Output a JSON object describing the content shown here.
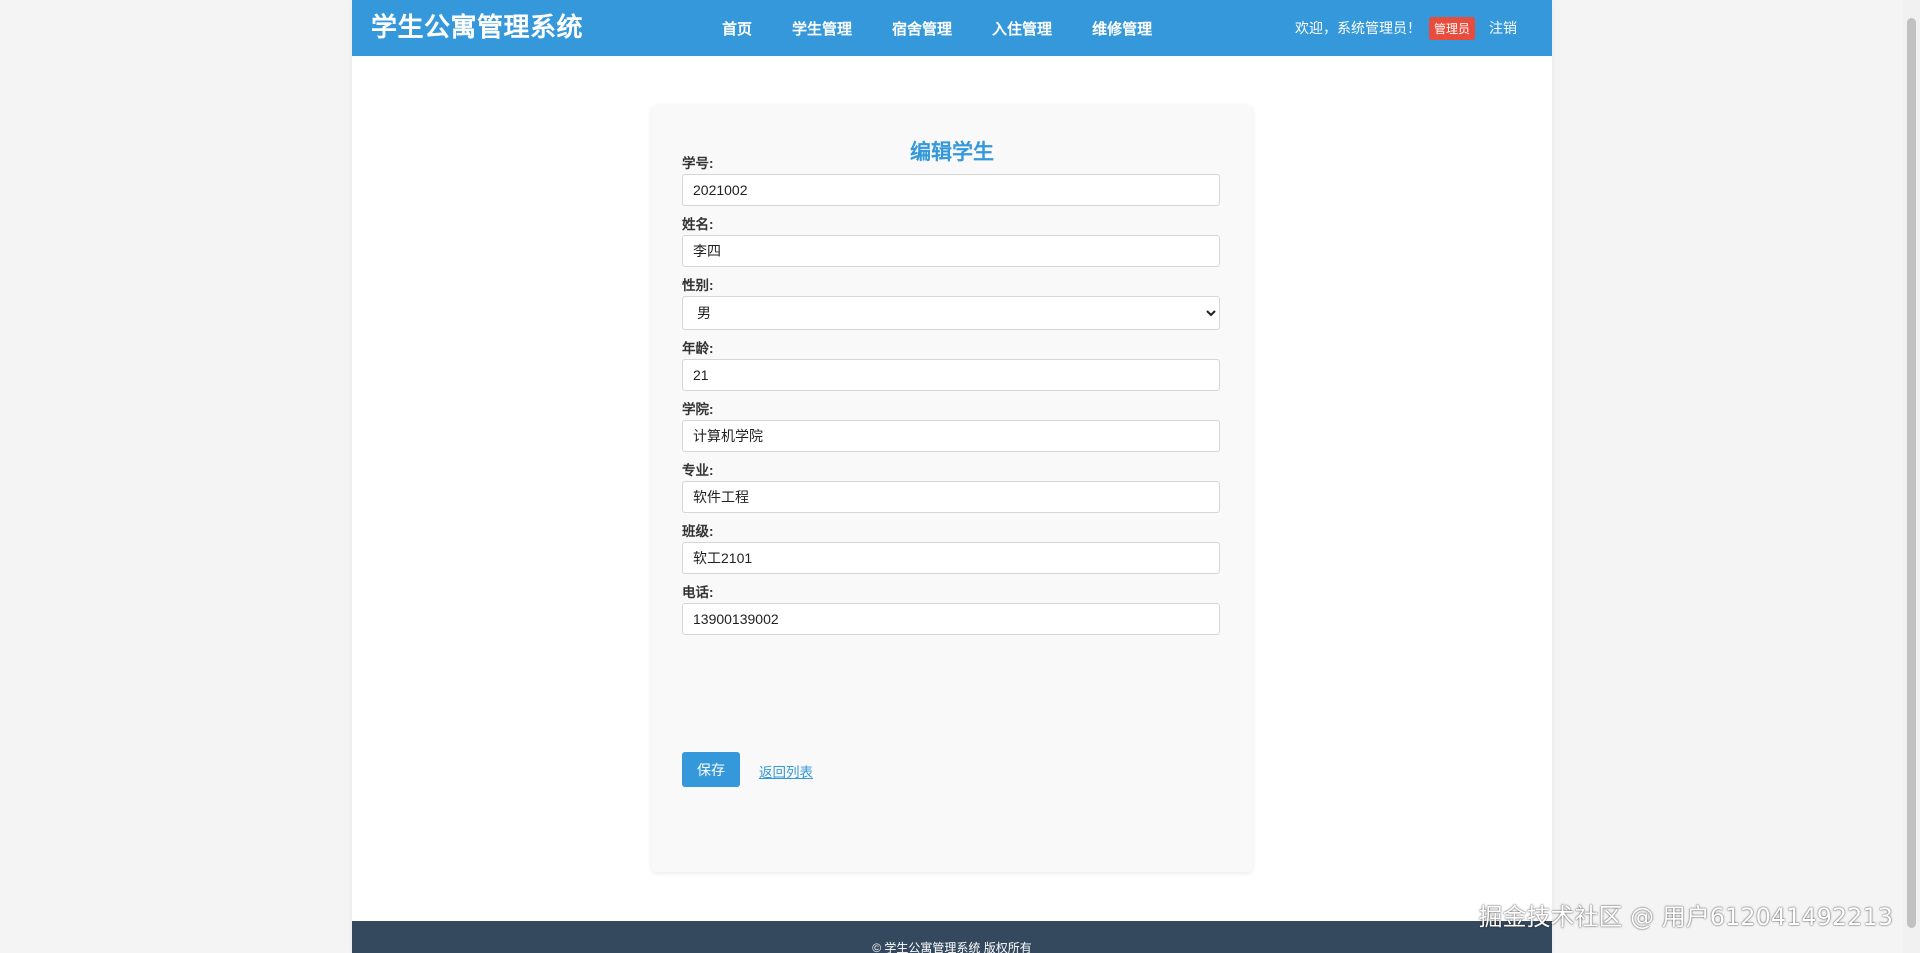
{
  "header": {
    "brand": "学生公寓管理系统",
    "nav": [
      "首页",
      "学生管理",
      "宿舍管理",
      "入住管理",
      "维修管理"
    ],
    "welcome": "欢迎，系统管理员！",
    "role_badge": "管理员",
    "logout": "注销",
    "colors": {
      "bar": "#3498db",
      "badge": "#e74c3c"
    }
  },
  "form": {
    "title": "编辑学生",
    "fields": {
      "student_id": {
        "label": "学号:",
        "value": "2021002"
      },
      "name": {
        "label": "姓名:",
        "value": "李四"
      },
      "gender": {
        "label": "性别:",
        "value": "男"
      },
      "age": {
        "label": "年龄:",
        "value": "21"
      },
      "college": {
        "label": "学院:",
        "value": "计算机学院"
      },
      "major": {
        "label": "专业:",
        "value": "软件工程"
      },
      "class": {
        "label": "班级:",
        "value": "软工2101"
      },
      "phone": {
        "label": "电话:",
        "value": "13900139002"
      }
    },
    "save_label": "保存",
    "back_label": "返回列表"
  },
  "footer": {
    "text": "© 学生公寓管理系统 版权所有"
  },
  "watermark": "掘金技术社区 @ 用户612041492213"
}
